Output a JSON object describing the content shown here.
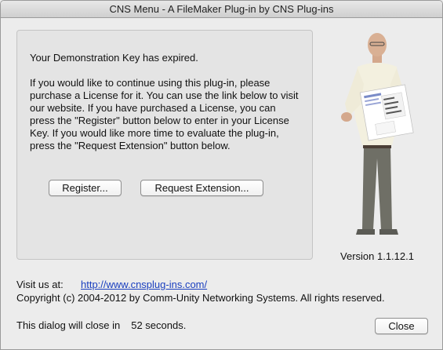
{
  "window": {
    "title": "CNS Menu - A FileMaker Plug-in by CNS Plug-ins"
  },
  "message": {
    "line1": "Your Demonstration Key has expired.",
    "body": "If you would like to continue using this plug-in, please purchase a License for it.  You can use the link below to visit our website.  If you have purchased a License, you can press the \"Register\" button below to enter in your License Key. If you would like more time to evaluate the plug-in, press the \"Request Extension\" button below."
  },
  "buttons": {
    "register": "Register...",
    "request_extension": "Request Extension...",
    "close": "Close"
  },
  "version": "Version 1.1.12.1",
  "footer": {
    "visit_label": "Visit us at:",
    "url": "http://www.cnsplug-ins.com/",
    "copyright": "Copyright (c) 2004-2012 by Comm-Unity Networking Systems. All rights reserved.",
    "countdown_label": "This dialog will close in",
    "countdown_value": "52 seconds."
  },
  "illustration": {
    "icon": "presenter-figure-icon"
  }
}
